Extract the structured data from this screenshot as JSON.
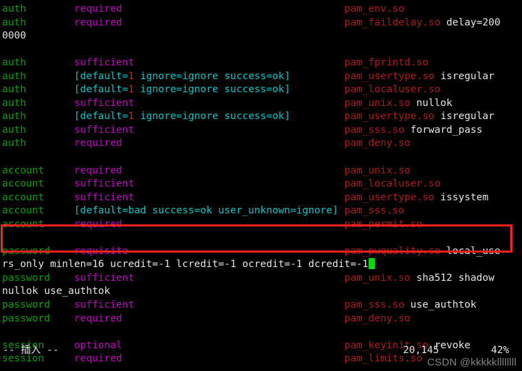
{
  "terminal": {
    "background": "#000000",
    "cursor_color": "#00e000",
    "annotation_color": "#ff2020",
    "colors": {
      "type": "#00a000",
      "control": "#c000c0",
      "bracket": "#00c8c8",
      "number": "#d02020",
      "module": "#b01818",
      "argument": "#e6e6e6"
    }
  },
  "editor": {
    "mode_label": "-- 插入 --",
    "cursor_position": "20,145",
    "scroll_percent": "42%"
  },
  "watermark": {
    "text": "CSDN @kkkkkllllllll"
  },
  "lines": [
    {
      "id": "line-1",
      "type": "auth",
      "control": "required",
      "module": "pam_env.so",
      "args": ""
    },
    {
      "id": "line-2",
      "type": "auth",
      "control": "required",
      "module": "pam_faildelay.so",
      "args": "delay=200",
      "wrap": "0000"
    },
    {
      "id": "line-3",
      "type": "",
      "control": "",
      "module": "",
      "args": ""
    },
    {
      "id": "line-4",
      "type": "auth",
      "control": "sufficient",
      "module": "pam_fprintd.so",
      "args": ""
    },
    {
      "id": "line-5",
      "type": "auth",
      "control": "[default=1 ignore=ignore success=ok]",
      "module": "pam_usertype.so",
      "args": "isregular"
    },
    {
      "id": "line-6",
      "type": "auth",
      "control": "[default=1 ignore=ignore success=ok]",
      "module": "pam_localuser.so",
      "args": ""
    },
    {
      "id": "line-7",
      "type": "auth",
      "control": "sufficient",
      "module": "pam_unix.so",
      "args": "nullok"
    },
    {
      "id": "line-8",
      "type": "auth",
      "control": "[default=1 ignore=ignore success=ok]",
      "module": "pam_usertype.so",
      "args": "isregular"
    },
    {
      "id": "line-9",
      "type": "auth",
      "control": "sufficient",
      "module": "pam_sss.so",
      "args": "forward_pass"
    },
    {
      "id": "line-10",
      "type": "auth",
      "control": "required",
      "module": "pam_deny.so",
      "args": ""
    },
    {
      "id": "line-11",
      "type": "",
      "control": "",
      "module": "",
      "args": ""
    },
    {
      "id": "line-12",
      "type": "account",
      "control": "required",
      "module": "pam_unix.so",
      "args": ""
    },
    {
      "id": "line-13",
      "type": "account",
      "control": "sufficient",
      "module": "pam_localuser.so",
      "args": ""
    },
    {
      "id": "line-14",
      "type": "account",
      "control": "sufficient",
      "module": "pam_usertype.so",
      "args": "issystem"
    },
    {
      "id": "line-15",
      "type": "account",
      "control": "[default=bad success=ok user_unknown=ignore]",
      "module": "pam_sss.so",
      "args": ""
    },
    {
      "id": "line-16",
      "type": "account",
      "control": "required",
      "module": "pam_permit.so",
      "args": ""
    },
    {
      "id": "line-17",
      "type": "",
      "control": "",
      "module": "",
      "args": ""
    },
    {
      "id": "line-18",
      "type": "password",
      "control": "requisite",
      "module": "pam_pwquality.so",
      "args": "local_use",
      "wrap": "rs_only minlen=16 ucredit=-1 lcredit=-1 ocredit=-1 dcredit=-1",
      "cursor_after_wrap": true,
      "highlighted": true
    },
    {
      "id": "line-19",
      "type": "password",
      "control": "sufficient",
      "module": "pam_unix.so",
      "args": "sha512 shadow",
      "wrap": "nullok use_authtok"
    },
    {
      "id": "line-20",
      "type": "password",
      "control": "sufficient",
      "module": "pam_sss.so",
      "args": "use_authtok"
    },
    {
      "id": "line-21",
      "type": "password",
      "control": "required",
      "module": "pam_deny.so",
      "args": ""
    },
    {
      "id": "line-22",
      "type": "",
      "control": "",
      "module": "",
      "args": ""
    },
    {
      "id": "line-23",
      "type": "session",
      "control": "optional",
      "module": "pam_keyinit.so",
      "args": "revoke"
    },
    {
      "id": "line-24",
      "type": "session",
      "control": "required",
      "module": "pam_limits.so",
      "args": ""
    }
  ]
}
